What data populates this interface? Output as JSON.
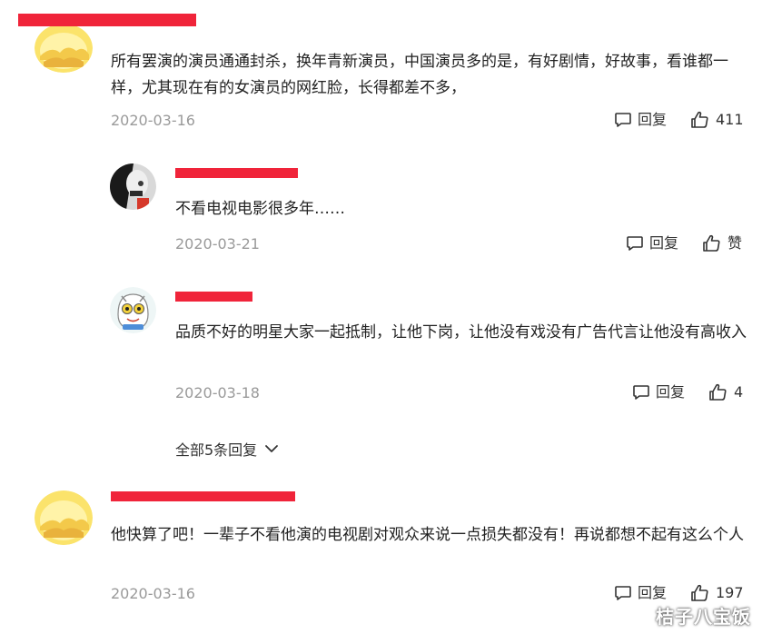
{
  "comments": [
    {
      "username": "",
      "text": "所有罢演的演员通通封杀，换年青新演员，中国演员多的是，有好剧情，好故事，看谁都一样，尤其现在有的女演员的网红脸，长得都差不多，",
      "date": "2020-03-16",
      "reply_label": "回复",
      "like_count": "411"
    },
    {
      "username": "",
      "text": "不看电视电影很多年……",
      "date": "2020-03-21",
      "reply_label": "回复",
      "like_count": "赞"
    },
    {
      "username": "",
      "text": "品质不好的明星大家一起抵制，让他下岗，让他没有戏没有广告代言让他没有高收入",
      "date": "2020-03-18",
      "reply_label": "回复",
      "like_count": "4"
    },
    {
      "username": "",
      "text": "他快算了吧！一辈子不看他演的电视剧对观众来说一点损失都没有！再说都想不起有这么个人",
      "date": "2020-03-16",
      "reply_label": "回复",
      "like_count": "197"
    }
  ],
  "more_replies_label": "全部5条回复",
  "watermark": "桔子八宝饭",
  "icons": {
    "reply": "comment-bubble-icon",
    "like": "thumbs-up-icon",
    "expand": "chevron-down-icon"
  },
  "colors": {
    "redaction": "#f0243a",
    "date": "#9a9a9a",
    "text": "#222222"
  }
}
